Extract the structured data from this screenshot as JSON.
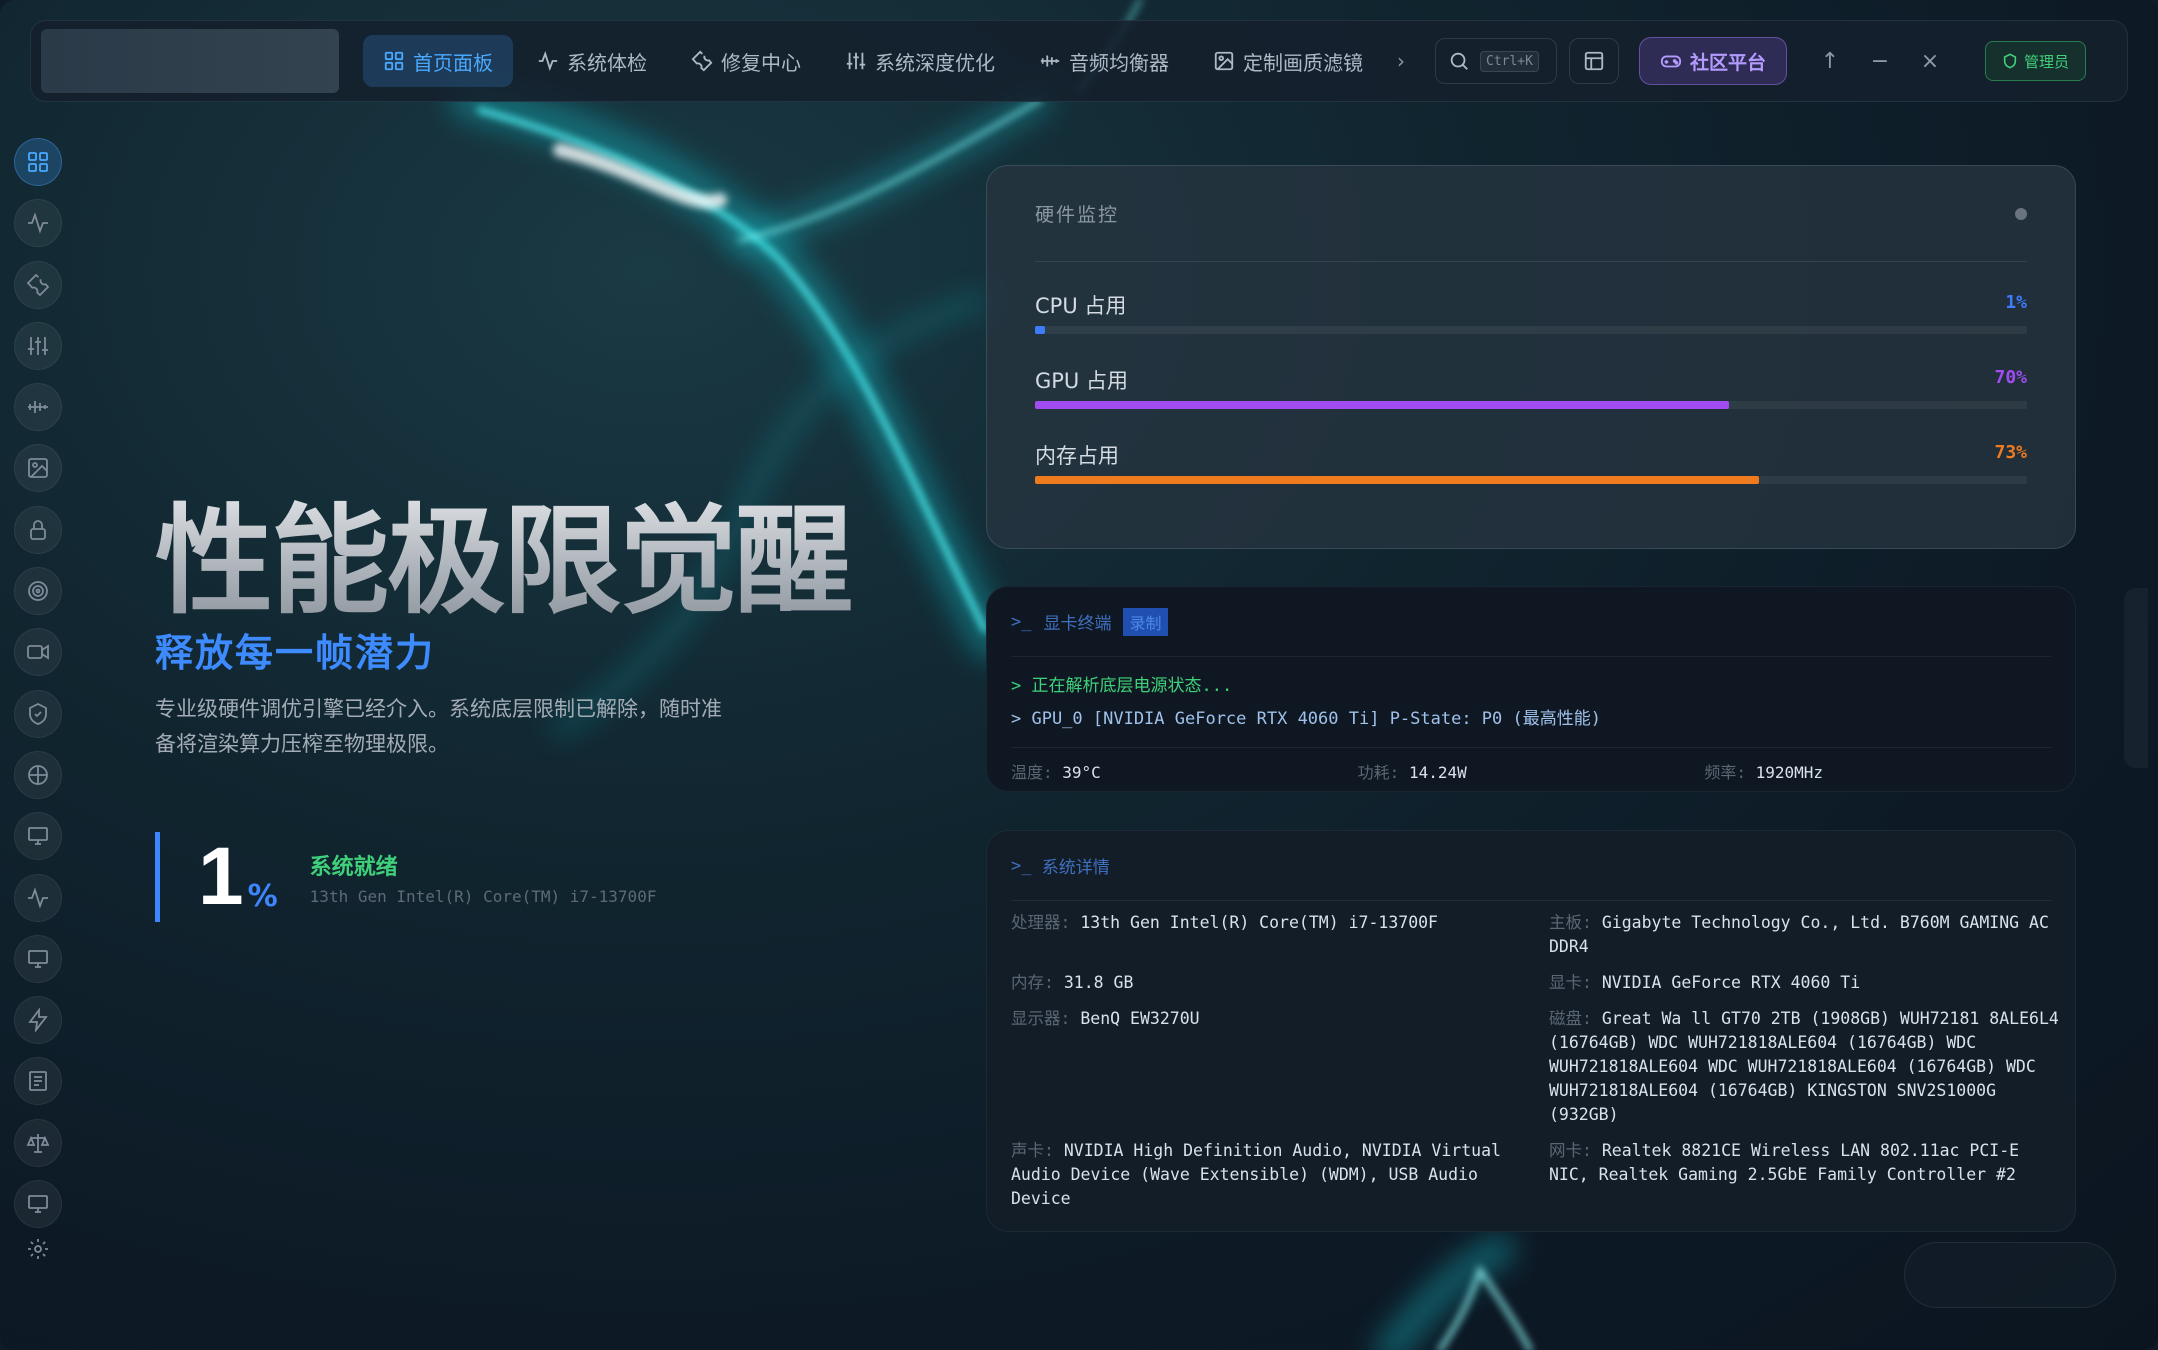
{
  "topbar": {
    "tabs": [
      {
        "label": "首页面板",
        "icon": "grid-icon",
        "active": true
      },
      {
        "label": "系统体检",
        "icon": "pulse-icon",
        "active": false
      },
      {
        "label": "修复中心",
        "icon": "wrench-icon",
        "active": false
      },
      {
        "label": "系统深度优化",
        "icon": "sliders-icon",
        "active": false
      },
      {
        "label": "音频均衡器",
        "icon": "equalizer-icon",
        "active": false
      },
      {
        "label": "定制画质滤镜",
        "icon": "image-icon",
        "active": false
      }
    ],
    "more_glyph": "›",
    "search_shortcut": "Ctrl+K",
    "community_label": "社区平台",
    "admin_label": "管理员",
    "window_controls": [
      "↑",
      "−",
      "×"
    ]
  },
  "sidebar": {
    "icons": [
      "grid-icon",
      "pulse-icon",
      "wrench-icon",
      "sliders-icon",
      "equalizer-icon",
      "image-icon",
      "lock-icon",
      "target-icon",
      "camera-icon",
      "shield-icon",
      "globe-icon",
      "monitor-icon",
      "pulse-icon",
      "monitor-icon",
      "bolt-icon",
      "list-icon",
      "scale-icon",
      "monitor-icon",
      "gear-icon"
    ]
  },
  "hero": {
    "title": "性能极限觉醒",
    "subtitle": "释放每一帧潜力",
    "description": "专业级硬件调优引擎已经介入。系统底层限制已解除，随时准备将渲染算力压榨至物理极限。",
    "big_number": "1",
    "big_unit": "%",
    "status": "系统就绪",
    "cpu_model": "13th Gen Intel(R) Core(TM) i7-13700F"
  },
  "hardware_monitor": {
    "title": "硬件监控",
    "meters": [
      {
        "label": "CPU 占用",
        "value": "1%",
        "fraction": 0.01,
        "color": "#3e7bff"
      },
      {
        "label": "GPU 占用",
        "value": "70%",
        "fraction": 0.7,
        "color": "#a04cf0"
      },
      {
        "label": "内存占用",
        "value": "73%",
        "fraction": 0.73,
        "color": "#f07a1e"
      }
    ]
  },
  "gpu_terminal": {
    "prompt": ">_",
    "title": "显卡终端",
    "badge": "录制",
    "lines": [
      {
        "text": "> 正在解析底层电源状态...",
        "color": "#3fd07a"
      },
      {
        "text": "> GPU_0 [NVIDIA GeForce RTX 4060 Ti] P-State: P0 (最高性能)",
        "color": "#9fc1ea"
      }
    ],
    "stats": [
      {
        "key": "温度:",
        "value": "39°C"
      },
      {
        "key": "功耗:",
        "value": "14.24W"
      },
      {
        "key": "频率:",
        "value": "1920MHz"
      }
    ]
  },
  "system_details": {
    "prompt": ">_",
    "title": "系统详情",
    "cpu_key": "处理器:",
    "cpu_value": "13th Gen Intel(R) Core(TM) i7-13700F",
    "board_key": "主板:",
    "board_value": "Gigabyte Technology Co., Ltd. B760M GAMING AC DDR4",
    "ram_key": "内存:",
    "ram_value": "31.8 GB",
    "gpu_key": "显卡:",
    "gpu_value": "NVIDIA GeForce RTX 4060 Ti",
    "display_key": "显示器:",
    "display_value": "BenQ EW3270U",
    "disk_key": "磁盘:",
    "disk_value": "Great Wa ll GT70 2TB (1908GB) WUH72181 8ALE6L4 (16764GB) WDC WUH721818ALE604 (16764GB) WDC WUH721818ALE604 WDC WUH721818ALE604 (16764GB) WDC WUH721818ALE604 (16764GB) KINGSTON SNV2S1000G (932GB)",
    "audio_key": "声卡:",
    "audio_value": "NVIDIA High Definition Audio, NVIDIA Virtual Audio Device (Wave Extensible) (WDM), USB Audio Device",
    "nic_key": "网卡:",
    "nic_value": "Realtek 8821CE Wireless LAN 802.11ac PCI-E NIC, Realtek Gaming 2.5GbE Family Controller #2"
  }
}
